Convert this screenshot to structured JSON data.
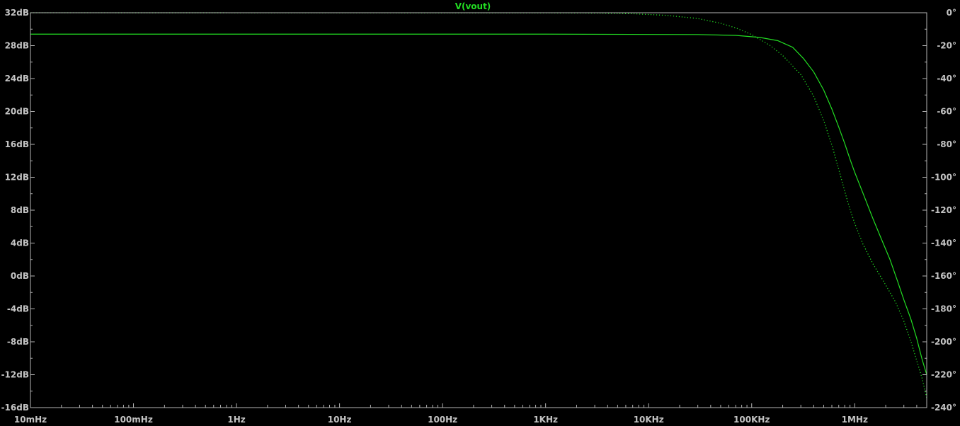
{
  "colors": {
    "background": "#000000",
    "frame": "#b4b4b4",
    "label": "#c4c4c4",
    "trace": "#22dd22"
  },
  "chart_data": {
    "type": "line",
    "title": "V(vout)",
    "x_scale": "log",
    "x_range_hz": [
      0.01,
      5000000
    ],
    "x_ticks": [
      {
        "value": 0.01,
        "label": "10mHz"
      },
      {
        "value": 0.1,
        "label": "100mHz"
      },
      {
        "value": 1,
        "label": "1Hz"
      },
      {
        "value": 10,
        "label": "10Hz"
      },
      {
        "value": 100,
        "label": "100Hz"
      },
      {
        "value": 1000,
        "label": "1KHz"
      },
      {
        "value": 10000,
        "label": "10KHz"
      },
      {
        "value": 100000,
        "label": "100KHz"
      },
      {
        "value": 1000000,
        "label": "1MHz"
      }
    ],
    "y_left_range": [
      -16,
      32
    ],
    "y_left_ticks": [
      {
        "value": 32,
        "label": "32dB"
      },
      {
        "value": 28,
        "label": "28dB"
      },
      {
        "value": 24,
        "label": "24dB"
      },
      {
        "value": 20,
        "label": "20dB"
      },
      {
        "value": 16,
        "label": "16dB"
      },
      {
        "value": 12,
        "label": "12dB"
      },
      {
        "value": 8,
        "label": "8dB"
      },
      {
        "value": 4,
        "label": "4dB"
      },
      {
        "value": 0,
        "label": "0dB"
      },
      {
        "value": -4,
        "label": "-4dB"
      },
      {
        "value": -8,
        "label": "-8dB"
      },
      {
        "value": -12,
        "label": "-12dB"
      },
      {
        "value": -16,
        "label": "-16dB"
      }
    ],
    "y_right_range": [
      -240,
      0
    ],
    "y_right_ticks": [
      {
        "value": 0,
        "label": "0°"
      },
      {
        "value": -20,
        "label": "-20°"
      },
      {
        "value": -40,
        "label": "-40°"
      },
      {
        "value": -60,
        "label": "-60°"
      },
      {
        "value": -80,
        "label": "-80°"
      },
      {
        "value": -100,
        "label": "-100°"
      },
      {
        "value": -120,
        "label": "-120°"
      },
      {
        "value": -140,
        "label": "-140°"
      },
      {
        "value": -160,
        "label": "-160°"
      },
      {
        "value": -180,
        "label": "-180°"
      },
      {
        "value": -200,
        "label": "-200°"
      },
      {
        "value": -220,
        "label": "-220°"
      },
      {
        "value": -240,
        "label": "-240°"
      }
    ],
    "series": [
      {
        "axis": "left",
        "style": "solid",
        "points": [
          [
            0.01,
            29.4
          ],
          [
            1000,
            29.4
          ],
          [
            30000,
            29.35
          ],
          [
            70000,
            29.25
          ],
          [
            120000,
            29.0
          ],
          [
            180000,
            28.6
          ],
          [
            250000,
            27.8
          ],
          [
            320000,
            26.4
          ],
          [
            400000,
            24.8
          ],
          [
            500000,
            22.6
          ],
          [
            600000,
            20.3
          ],
          [
            700000,
            18.1
          ],
          [
            800000,
            16.1
          ],
          [
            900000,
            14.2
          ],
          [
            1000000,
            12.6
          ],
          [
            1200000,
            10.1
          ],
          [
            1500000,
            7.0
          ],
          [
            1800000,
            4.6
          ],
          [
            2200000,
            2.0
          ],
          [
            2600000,
            -0.6
          ],
          [
            3000000,
            -2.9
          ],
          [
            3500000,
            -5.2
          ],
          [
            4000000,
            -7.6
          ],
          [
            4500000,
            -10.1
          ],
          [
            5000000,
            -12.0
          ]
        ]
      },
      {
        "axis": "right",
        "style": "dotted",
        "points": [
          [
            0.01,
            0
          ],
          [
            1000,
            -0.1
          ],
          [
            3000,
            -0.2
          ],
          [
            7000,
            -0.6
          ],
          [
            15000,
            -1.6
          ],
          [
            30000,
            -3.5
          ],
          [
            50000,
            -6.4
          ],
          [
            70000,
            -9.2
          ],
          [
            100000,
            -13.3
          ],
          [
            150000,
            -19.8
          ],
          [
            200000,
            -26.0
          ],
          [
            300000,
            -37.6
          ],
          [
            400000,
            -50.8
          ],
          [
            500000,
            -65.5
          ],
          [
            600000,
            -80.4
          ],
          [
            700000,
            -95.2
          ],
          [
            800000,
            -108.5
          ],
          [
            900000,
            -119.5
          ],
          [
            1000000,
            -128.0
          ],
          [
            1200000,
            -140.5
          ],
          [
            1500000,
            -152.5
          ],
          [
            2000000,
            -165.5
          ],
          [
            2500000,
            -176.0
          ],
          [
            3000000,
            -187.5
          ],
          [
            3500000,
            -199.5
          ],
          [
            4000000,
            -211.5
          ],
          [
            4500000,
            -222.0
          ],
          [
            5000000,
            -234.0
          ]
        ]
      }
    ]
  }
}
